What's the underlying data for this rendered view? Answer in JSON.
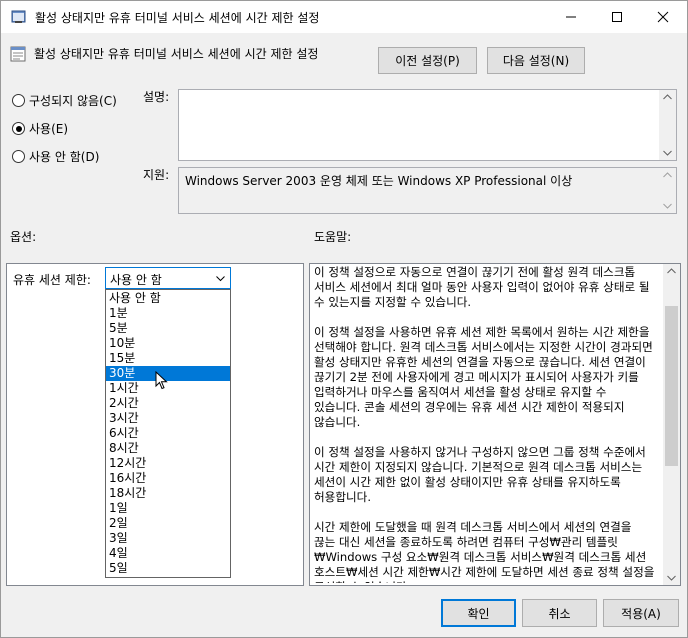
{
  "window": {
    "title": "활성 상태지만 유휴 터미널 서비스 세션에 시간 제한 설정"
  },
  "header": {
    "policy_title": "활성 상태지만 유휴 터미널 서비스 세션에 시간 제한 설정",
    "prev_button": "이전 설정(P)",
    "next_button": "다음 설정(N)"
  },
  "state": {
    "options": [
      {
        "label": "구성되지 않음(C)",
        "selected": false
      },
      {
        "label": "사용(E)",
        "selected": true
      },
      {
        "label": "사용 안 함(D)",
        "selected": false
      }
    ]
  },
  "comment": {
    "label": "설명:",
    "value": ""
  },
  "supported": {
    "label": "지원:",
    "value": "Windows Server 2003 운영 체제 또는 Windows XP Professional 이상"
  },
  "options_section": {
    "label": "옵션:",
    "idle_label": "유휴 세션 제한:",
    "combo_value": "사용 안 함",
    "dropdown_items": [
      "사용 안 함",
      "1분",
      "5분",
      "10분",
      "15분",
      "30분",
      "1시간",
      "2시간",
      "3시간",
      "6시간",
      "8시간",
      "12시간",
      "16시간",
      "18시간",
      "1일",
      "2일",
      "3일",
      "4일",
      "5일"
    ],
    "highlighted": "30분"
  },
  "help_section": {
    "label": "도움말:",
    "paragraphs": [
      "이 정책 설정으로 자동으로 연결이 끊기기 전에 활성 원격 데스크톱 서비스 세션에서 최대 얼마 동안 사용자 입력이 없어야 유휴 상태로 될 수 있는지를 지정할 수 있습니다.",
      "이 정책 설정을 사용하면 유휴 세션 제한 목록에서 원하는 시간 제한을 선택해야 합니다. 원격 데스크톱 서비스에서는 지정한 시간이 경과되면 활성 상태지만 유휴한 세션의 연결을 자동으로 끊습니다. 세션 연결이 끊기기 2분 전에 사용자에게 경고 메시지가 표시되어 사용자가 키를 입력하거나 마우스를 움직여서 세션을 활성 상태로 유지할 수 있습니다. 콘솔 세션의 경우에는 유휴 세션 시간 제한이 적용되지 않습니다.",
      "이 정책 설정을 사용하지 않거나 구성하지 않으면 그룹 정책 수준에서 시간 제한이 지정되지 않습니다. 기본적으로 원격 데스크톱 서비스는 세션이 시간 제한 없이 활성 상태이지만 유휴 상태를 유지하도록 허용합니다.",
      "시간 제한에 도달했을 때 원격 데스크톱 서비스에서 세션의 연결을 끊는 대신 세션을 종료하도록 하려면 컴퓨터 구성₩관리 템플릿₩Windows 구성 요소₩원격 데스크톱 서비스₩원격 데스크톱 세션 호스트₩세션 시간 제한₩시간 제한에 도달하면 세션 종료 정책 설정을 구성할 수 있습니다."
    ]
  },
  "footer": {
    "ok": "확인",
    "cancel": "취소",
    "apply": "적용(A)"
  }
}
